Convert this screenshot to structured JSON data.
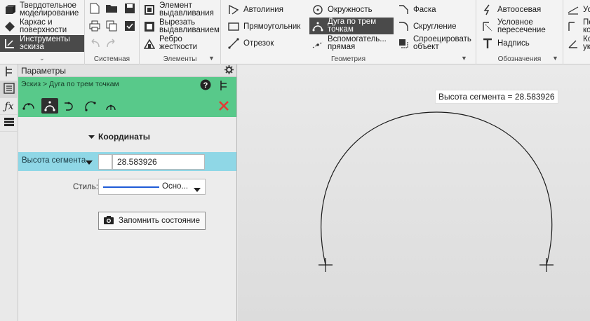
{
  "ribbon": {
    "groups": [
      {
        "name": "model",
        "items": [
          "Твердотельное\nмоделирование",
          "Каркас и\nповерхности",
          "Инструменты\nэскиза"
        ]
      },
      {
        "name": "system",
        "label": "Системная"
      },
      {
        "name": "elements",
        "label": "Элементы",
        "items": [
          "Элемент\nвыдавливания",
          "Вырезать\nвыдавливанием",
          "Ребро\nжесткости"
        ]
      },
      {
        "name": "geometry",
        "label": "Геометрия",
        "items": [
          "Автолиния",
          "Прямоугольник",
          "Отрезок",
          "Окружность",
          "Дуга по трем\nточкам",
          "Вспомогатель...\nпрямая",
          "Фаска",
          "Скругление",
          "Спроецировать\nобъект"
        ]
      },
      {
        "name": "designations",
        "label": "Обозначения",
        "items": [
          "Автоосевая",
          "Условное\nпересечение",
          "Надпись"
        ]
      },
      {
        "name": "overflow",
        "items": [
          "Ус",
          "Пе\nко",
          "Ко\nук"
        ]
      }
    ]
  },
  "panel": {
    "title": "Параметры",
    "breadcrumb": "Эскиз > Дуга по трем точкам",
    "coordinates_label": "Координаты",
    "param_label": "Высота сегмента",
    "param_value": "28.583926",
    "style_label": "Стиль:",
    "style_value": "Осно...",
    "remember_label": "Запомнить состояние"
  },
  "canvas": {
    "tooltip": "Высота сегмента = 28.583926"
  },
  "colors": {
    "accent_green": "#58c98a",
    "param_row": "#8fd7e6",
    "cancel_red": "#e53935",
    "line_blue": "#1e5bd6"
  }
}
